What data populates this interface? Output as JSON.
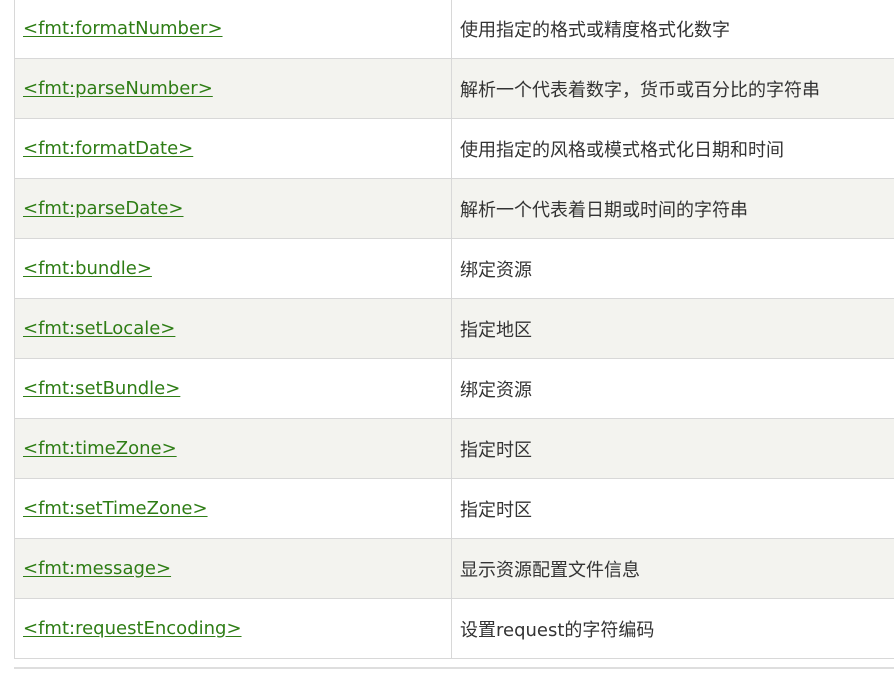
{
  "table": {
    "rows": [
      {
        "tag": "<fmt:formatNumber>",
        "description": "使用指定的格式或精度格式化数字"
      },
      {
        "tag": "<fmt:parseNumber>",
        "description": "解析一个代表着数字，货币或百分比的字符串"
      },
      {
        "tag": "<fmt:formatDate>",
        "description": "使用指定的风格或模式格式化日期和时间"
      },
      {
        "tag": "<fmt:parseDate>",
        "description": "解析一个代表着日期或时间的字符串"
      },
      {
        "tag": "<fmt:bundle>",
        "description": "绑定资源"
      },
      {
        "tag": "<fmt:setLocale>",
        "description": "指定地区"
      },
      {
        "tag": "<fmt:setBundle>",
        "description": "绑定资源"
      },
      {
        "tag": "<fmt:timeZone>",
        "description": "指定时区"
      },
      {
        "tag": "<fmt:setTimeZone>",
        "description": "指定时区"
      },
      {
        "tag": "<fmt:message>",
        "description": "显示资源配置文件信息"
      },
      {
        "tag": "<fmt:requestEncoding>",
        "description": "设置request的字符编码"
      }
    ]
  },
  "colors": {
    "link": "#2e7d15",
    "text": "#333333",
    "row_alt": "#f3f3ef",
    "border": "#d8d8d8"
  }
}
